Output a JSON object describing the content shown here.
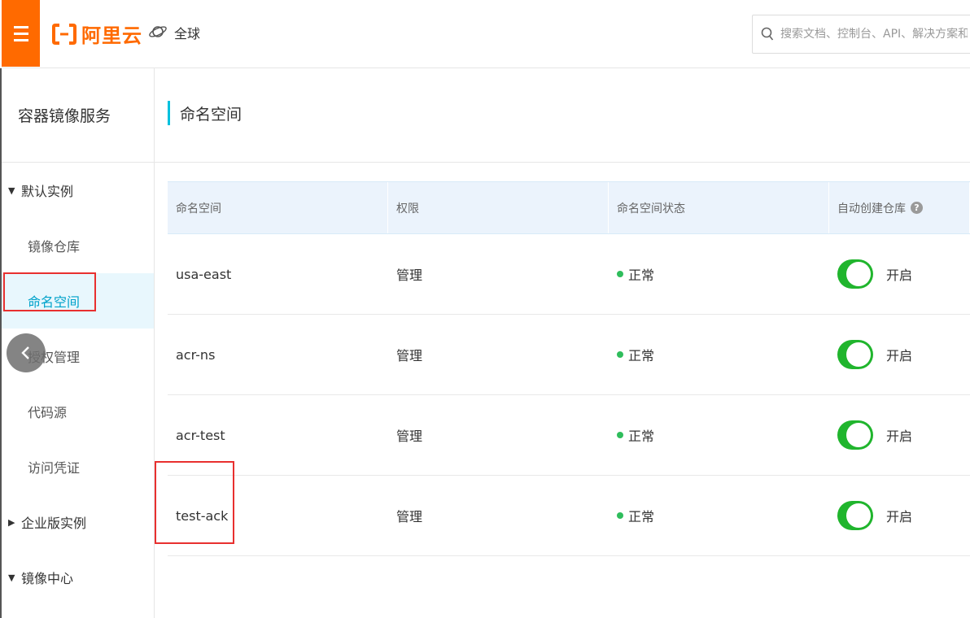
{
  "header": {
    "logo_text": "阿里云",
    "region_label": "全球",
    "search_placeholder": "搜索文档、控制台、API、解决方案和资源"
  },
  "sidebar": {
    "title": "容器镜像服务",
    "groups": [
      {
        "label": "默认实例",
        "expanded": true
      },
      {
        "label": "企业版实例",
        "expanded": false
      },
      {
        "label": "镜像中心",
        "expanded": true
      }
    ],
    "items": [
      {
        "label": "镜像仓库",
        "active": false
      },
      {
        "label": "命名空间",
        "active": true
      },
      {
        "label": "授权管理",
        "active": false
      },
      {
        "label": "代码源",
        "active": false
      },
      {
        "label": "访问凭证",
        "active": false
      }
    ]
  },
  "main": {
    "title": "命名空间",
    "columns": [
      "命名空间",
      "权限",
      "命名空间状态",
      "自动创建仓库"
    ],
    "help_glyph": "?",
    "rows": [
      {
        "namespace": "usa-east",
        "permission": "管理",
        "status": "正常",
        "auto_create": "开启"
      },
      {
        "namespace": "acr-ns",
        "permission": "管理",
        "status": "正常",
        "auto_create": "开启"
      },
      {
        "namespace": "acr-test",
        "permission": "管理",
        "status": "正常",
        "auto_create": "开启"
      },
      {
        "namespace": "test-ack",
        "permission": "管理",
        "status": "正常",
        "auto_create": "开启"
      }
    ]
  },
  "colors": {
    "brand": "#ff6a00",
    "accent": "#00a2ca",
    "toggle_on": "#20b52d",
    "status_ok": "#2fbd5c",
    "highlight": "#e8302f"
  }
}
